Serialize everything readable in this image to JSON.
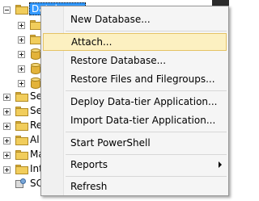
{
  "tree": {
    "selected_node": "Databases",
    "nodes": [
      {
        "label": ""
      },
      {
        "label": ""
      },
      {
        "label": ""
      },
      {
        "label": ""
      },
      {
        "label": ""
      },
      {
        "label": "Se"
      },
      {
        "label": "Se"
      },
      {
        "label": "Re"
      },
      {
        "label": "Al"
      },
      {
        "label": "Ma"
      },
      {
        "label": "Int"
      },
      {
        "label": "SC"
      }
    ]
  },
  "context_menu": {
    "items": [
      {
        "label": "New Database..."
      },
      {
        "label": "Attach..."
      },
      {
        "label": "Restore Database..."
      },
      {
        "label": "Restore Files and Filegroups..."
      },
      {
        "label": "Deploy Data-tier Application..."
      },
      {
        "label": "Import Data-tier Application..."
      },
      {
        "label": "Start PowerShell"
      },
      {
        "label": "Reports"
      },
      {
        "label": "Refresh"
      }
    ],
    "highlighted": "Attach..."
  }
}
